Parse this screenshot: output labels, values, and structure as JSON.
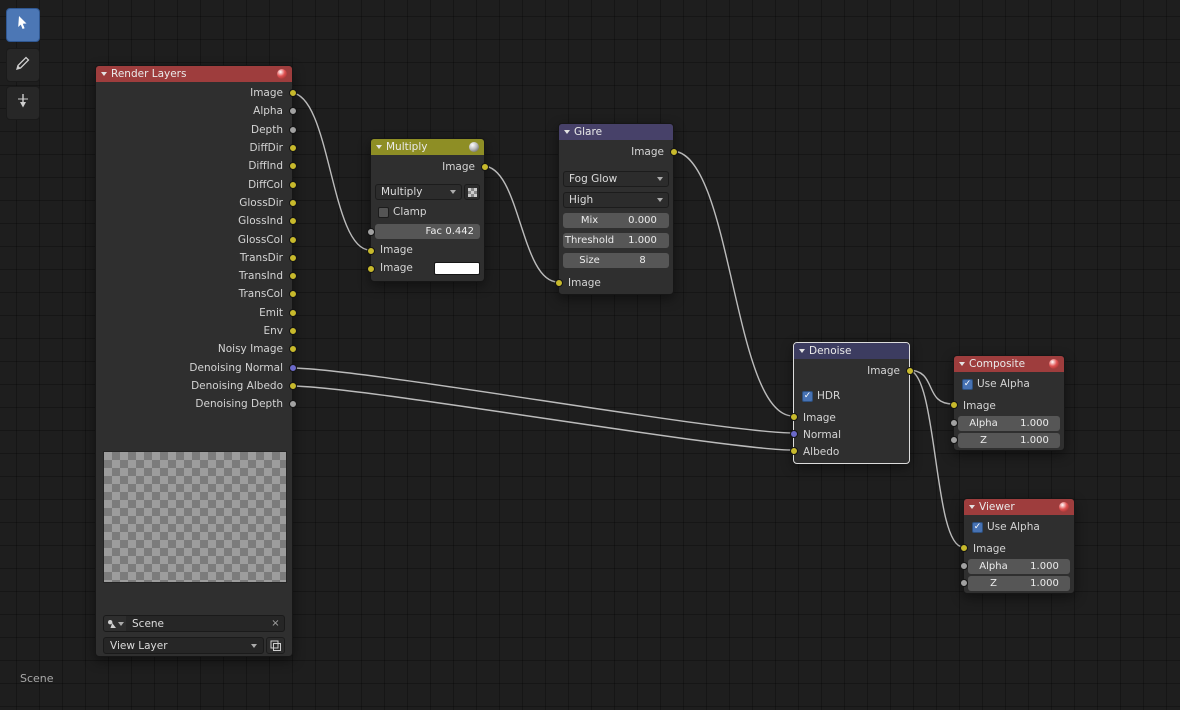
{
  "colors": {
    "accent": "#4772b3",
    "noodle": "#bcbcbc",
    "socket_color": "#c7b92c",
    "socket_value": "#a1a1a1",
    "socket_vector": "#6b69c9"
  },
  "status_bar": {
    "text": "Scene"
  },
  "toolbar": {
    "tools": [
      {
        "icon": "tweak-tool-icon",
        "active": true
      },
      {
        "icon": "annotate-icon",
        "active": false
      },
      {
        "icon": "knife-icon",
        "active": false
      }
    ]
  },
  "nodes": {
    "render_layers": {
      "title": "Render Layers",
      "outputs": [
        {
          "label": "Image",
          "type": "color"
        },
        {
          "label": "Alpha",
          "type": "value"
        },
        {
          "label": "Depth",
          "type": "value"
        },
        {
          "label": "DiffDir",
          "type": "color"
        },
        {
          "label": "DiffInd",
          "type": "color"
        },
        {
          "label": "DiffCol",
          "type": "color"
        },
        {
          "label": "GlossDir",
          "type": "color"
        },
        {
          "label": "GlossInd",
          "type": "color"
        },
        {
          "label": "GlossCol",
          "type": "color"
        },
        {
          "label": "TransDir",
          "type": "color"
        },
        {
          "label": "TransInd",
          "type": "color"
        },
        {
          "label": "TransCol",
          "type": "color"
        },
        {
          "label": "Emit",
          "type": "color"
        },
        {
          "label": "Env",
          "type": "color"
        },
        {
          "label": "Noisy Image",
          "type": "color"
        },
        {
          "label": "Denoising Normal",
          "type": "vector"
        },
        {
          "label": "Denoising Albedo",
          "type": "color"
        },
        {
          "label": "Denoising Depth",
          "type": "value"
        }
      ],
      "scene_value": "Scene",
      "close_glyph": "×",
      "view_layer_value": "View Layer"
    },
    "multiply": {
      "title": "Multiply",
      "output_label": "Image",
      "blend_mode": "Multiply",
      "clamp_label": "Clamp",
      "clamp_checked": false,
      "fac_label": "Fac",
      "fac_value": "0.442",
      "fac_fraction": 0.442,
      "input1_label": "Image",
      "input2_label": "Image"
    },
    "glare": {
      "title": "Glare",
      "output_label": "Image",
      "glare_type": "Fog Glow",
      "quality": "High",
      "mix_label": "Mix",
      "mix_value": "0.000",
      "threshold_label": "Threshold",
      "threshold_value": "1.000",
      "size_label": "Size",
      "size_value": "8",
      "input_label": "Image"
    },
    "denoise": {
      "title": "Denoise",
      "output_label": "Image",
      "hdr_label": "HDR",
      "hdr_checked": true,
      "inputs": [
        "Image",
        "Normal",
        "Albedo"
      ]
    },
    "composite": {
      "title": "Composite",
      "use_alpha_label": "Use Alpha",
      "use_alpha_checked": true,
      "image_label": "Image",
      "alpha_label": "Alpha",
      "alpha_value": "1.000",
      "z_label": "Z",
      "z_value": "1.000"
    },
    "viewer": {
      "title": "Viewer",
      "use_alpha_label": "Use Alpha",
      "use_alpha_checked": true,
      "image_label": "Image",
      "alpha_label": "Alpha",
      "alpha_value": "1.000",
      "z_label": "Z",
      "z_value": "1.000"
    }
  },
  "connections": [
    {
      "from": "render-layers.image",
      "to": "multiply.image-1"
    },
    {
      "from": "multiply.image-out",
      "to": "glare.image-in"
    },
    {
      "from": "glare.image-out",
      "to": "denoise.image-in"
    },
    {
      "from": "render-layers.denoising-normal",
      "to": "denoise.normal"
    },
    {
      "from": "render-layers.denoising-albedo",
      "to": "denoise.albedo"
    },
    {
      "from": "denoise.image-out",
      "to": "composite.image"
    },
    {
      "from": "denoise.image-out",
      "to": "viewer.image"
    }
  ]
}
